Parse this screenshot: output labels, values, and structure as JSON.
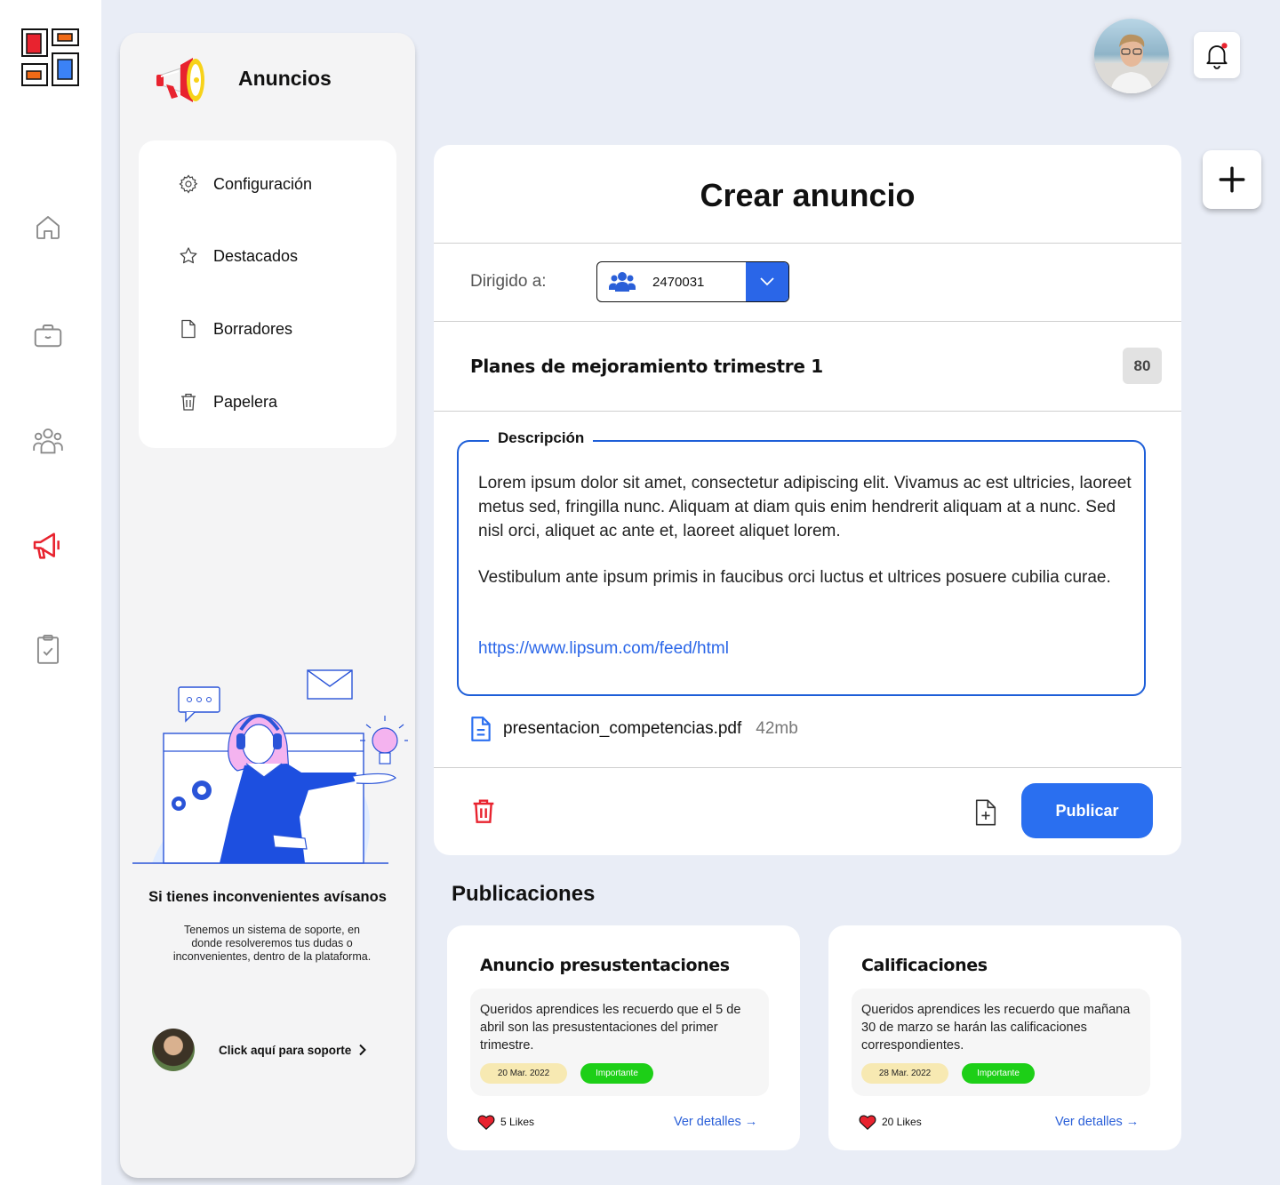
{
  "sidebar": {
    "title": "Anuncios",
    "menu": [
      {
        "label": "Configuración",
        "icon": "gear-icon"
      },
      {
        "label": "Destacados",
        "icon": "star-icon"
      },
      {
        "label": "Borradores",
        "icon": "document-icon"
      },
      {
        "label": "Papelera",
        "icon": "trash-icon"
      }
    ],
    "support": {
      "title": "Si tienes inconvenientes avísanos",
      "text": "Tenemos un sistema de soporte, en donde resolveremos tus dudas o inconvenientes, dentro de la plataforma.",
      "link_label": "Click aquí para soporte"
    }
  },
  "rail": {
    "items": [
      "home-icon",
      "briefcase-icon",
      "people-icon",
      "megaphone-icon",
      "clipboard-check-icon"
    ],
    "active": "megaphone-icon"
  },
  "form": {
    "title": "Crear anuncio",
    "directed_label": "Dirigido a:",
    "directed_value": "2470031",
    "subject": "Planes de mejoramiento trimestre 1",
    "char_counter": "80",
    "description_label": "Descripción",
    "description_p1": "Lorem ipsum dolor sit amet, consectetur adipiscing elit. Vivamus ac est ultricies, laoreet metus sed, fringilla nunc. Aliquam at diam quis enim hendrerit aliquam at a nunc. Sed nisl orci, aliquet ac ante et, laoreet aliquet lorem.",
    "description_p2": "Vestibulum ante ipsum primis in faucibus orci luctus et ultrices posuere cubilia curae.",
    "description_link": "https://www.lipsum.com/feed/html",
    "attachment": {
      "name": "presentacion_competencias.pdf",
      "size": "42mb"
    },
    "publish_label": "Publicar"
  },
  "publications": {
    "title": "Publicaciones",
    "items": [
      {
        "title": "Anuncio presustentaciones",
        "text": "Queridos aprendices les recuerdo que el 5 de abril son las presustentaciones del primer trimestre.",
        "date": "20 Mar. 2022",
        "tag": "Importante",
        "likes": "5 Likes",
        "details": "Ver detalles →"
      },
      {
        "title": "Calificaciones",
        "text": "Queridos aprendices les recuerdo que mañana 30 de marzo se harán las calificaciones correspondientes.",
        "date": "28 Mar. 2022",
        "tag": "Importante",
        "likes": "20 Likes",
        "details": "Ver detalles →"
      }
    ]
  },
  "colors": {
    "accent": "#2a6ff0",
    "active_rail": "#e8232f",
    "important": "#1dcf17",
    "date_chip": "#f7e9b2",
    "background": "#e9edf6"
  }
}
